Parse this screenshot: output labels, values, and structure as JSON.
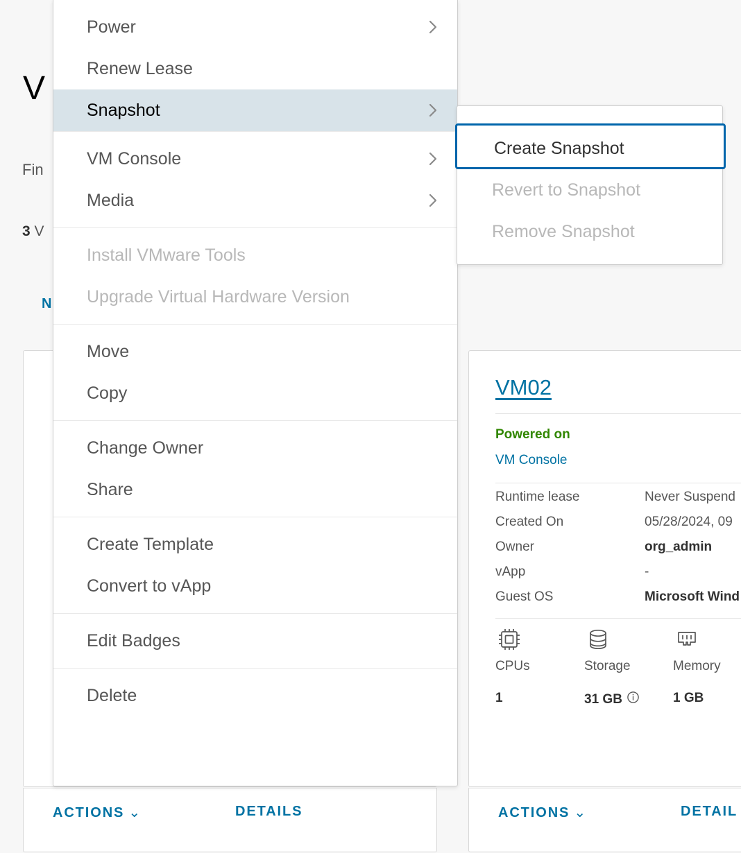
{
  "page": {
    "title": "V",
    "find_label": "Fin",
    "count_label_bold": "3",
    "count_label_rest": "V",
    "new_button": "N"
  },
  "context_menu": {
    "groups": [
      {
        "items": [
          {
            "label": "Power",
            "state": "enabled",
            "submenu": true
          },
          {
            "label": "Renew Lease",
            "state": "enabled",
            "submenu": false
          },
          {
            "label": "Snapshot",
            "state": "active",
            "submenu": true
          }
        ]
      },
      {
        "items": [
          {
            "label": "VM Console",
            "state": "enabled",
            "submenu": true
          },
          {
            "label": "Media",
            "state": "enabled",
            "submenu": true
          }
        ]
      },
      {
        "items": [
          {
            "label": "Install VMware Tools",
            "state": "disabled",
            "submenu": false
          },
          {
            "label": "Upgrade Virtual Hardware Version",
            "state": "disabled",
            "submenu": false
          }
        ]
      },
      {
        "items": [
          {
            "label": "Move",
            "state": "enabled",
            "submenu": false
          },
          {
            "label": "Copy",
            "state": "enabled",
            "submenu": false
          }
        ]
      },
      {
        "items": [
          {
            "label": "Change Owner",
            "state": "enabled",
            "submenu": false
          },
          {
            "label": "Share",
            "state": "enabled",
            "submenu": false
          }
        ]
      },
      {
        "items": [
          {
            "label": "Create Template",
            "state": "enabled",
            "submenu": false
          },
          {
            "label": "Convert to vApp",
            "state": "enabled",
            "submenu": false
          }
        ]
      },
      {
        "items": [
          {
            "label": "Edit Badges",
            "state": "enabled",
            "submenu": false
          }
        ]
      },
      {
        "items": [
          {
            "label": "Delete",
            "state": "enabled",
            "submenu": false
          }
        ]
      }
    ]
  },
  "submenu": {
    "items": [
      {
        "label": "Create Snapshot",
        "state": "focused"
      },
      {
        "label": "Revert to Snapshot",
        "state": "disabled"
      },
      {
        "label": "Remove Snapshot",
        "state": "disabled"
      }
    ]
  },
  "vm_card": {
    "name": "VM02",
    "status": "Powered on",
    "console_link": "VM Console",
    "properties": [
      {
        "key": "Runtime lease",
        "value": "Never Suspend",
        "strong": false
      },
      {
        "key": "Created On",
        "value": "05/28/2024, 09",
        "strong": false
      },
      {
        "key": "Owner",
        "value": "org_admin",
        "strong": true
      },
      {
        "key": "vApp",
        "value": "-",
        "strong": false
      },
      {
        "key": "Guest OS",
        "value": "Microsoft Wind",
        "strong": true
      }
    ],
    "stats": [
      {
        "icon": "cpu-icon",
        "label": "CPUs",
        "value": "1",
        "info": false
      },
      {
        "icon": "storage-icon",
        "label": "Storage",
        "value": "31 GB",
        "info": true
      },
      {
        "icon": "memory-icon",
        "label": "Memory",
        "value": "1 GB",
        "info": false
      }
    ]
  },
  "action_bars": {
    "actions_label": "ACTIONS",
    "details_label": "DETAILS",
    "details_label_right": "DETAIL"
  },
  "colors": {
    "accent": "#0072a3",
    "focus_ring": "#0065ab",
    "status_green": "#318700",
    "menu_highlight": "#d8e3e9",
    "background": "#f7f7f7"
  }
}
